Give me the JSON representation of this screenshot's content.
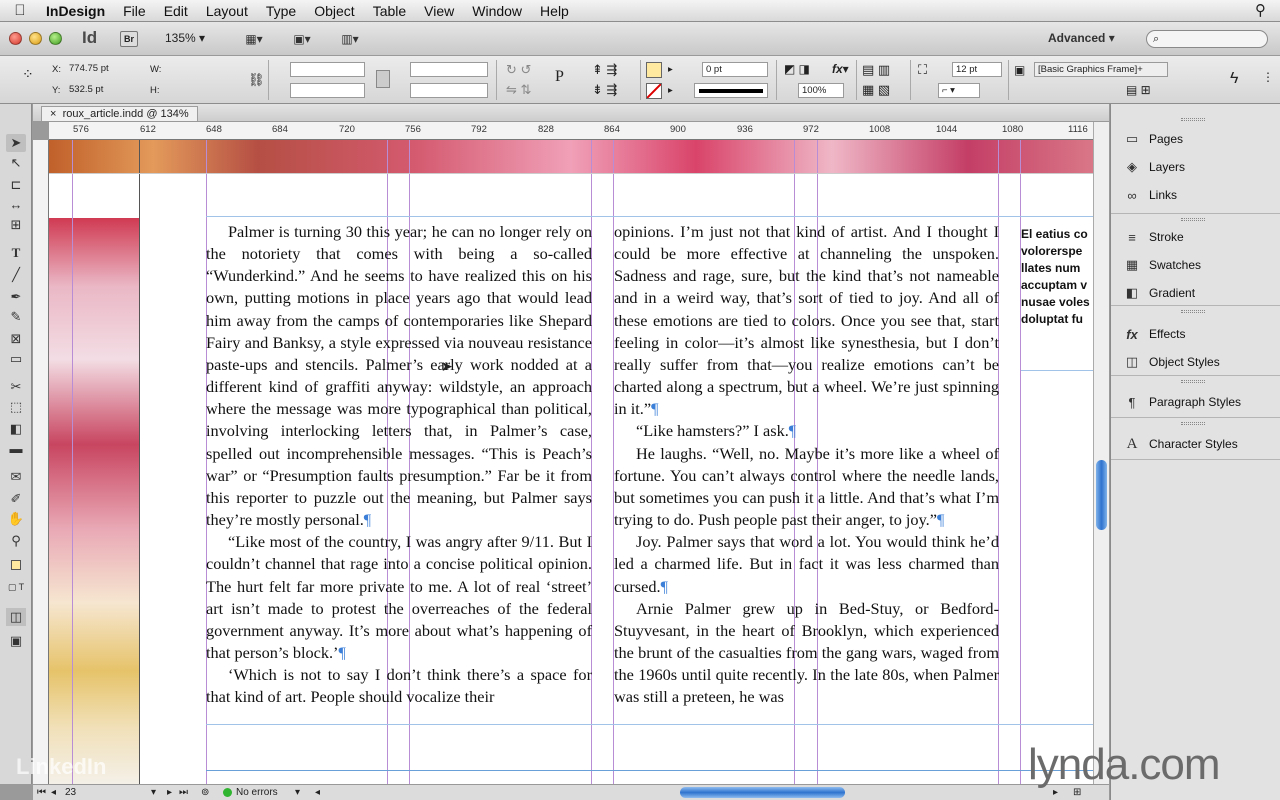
{
  "menubar": {
    "app": "InDesign",
    "menus": [
      "File",
      "Edit",
      "Layout",
      "Type",
      "Object",
      "Table",
      "View",
      "Window",
      "Help"
    ]
  },
  "appbar": {
    "logo": "Id",
    "bridge": "Br",
    "zoom": "135%",
    "workspace": "Advanced",
    "search_placeholder": "⌕"
  },
  "control": {
    "x_label": "X:",
    "x_value": "774.75 pt",
    "y_label": "Y:",
    "y_value": "532.5 pt",
    "w_label": "W:",
    "h_label": "H:",
    "stroke_weight": "0 pt",
    "opacity": "100%",
    "spacing": "12 pt",
    "object_style": "[Basic Graphics Frame]+"
  },
  "doc": {
    "tab_title": "roux_article.indd @ 134%",
    "ruler_ticks": [
      "576",
      "612",
      "648",
      "684",
      "720",
      "756",
      "792",
      "828",
      "864",
      "900",
      "936",
      "972",
      "1008",
      "1044",
      "1080",
      "1116"
    ]
  },
  "article": {
    "col1": [
      "Palmer is turning 30 this year; he can no longer rely on the notoriety that comes with being a so-called “Wunderkind.” And he seems to have realized this on his own, putting motions in place years ago that would lead him away from the camps of contemporaries like Shepard Fairy and Banksy, a style expressed via nouveau resistance paste-ups and stencils. Palmer’s early work nodded at a different kind of graffiti anyway: wildstyle, an approach where the message was more typographical than political, involving interlocking letters that, in Palmer’s case, spelled out incomprehensible messages. “This is Peach’s war” or “Presumption faults presumption.” Far be it from this reporter to puzzle out the meaning, but Palmer says they’re mostly personal.",
      "“Like most of the country, I was angry after 9/11. But I couldn’t channel that rage into a concise political opinion. The hurt felt far more private to me. A lot of real ‘street’ art isn’t made to protest the overreaches of the federal government anyway. It’s more about what’s happening of that person’s block.’",
      "‘Which is not to say I don’t think there’s a space for that kind of art. People should vocalize their"
    ],
    "col2": [
      "opinions. I’m just not that kind of artist. And I thought I could be more effective at channeling the unspoken. Sadness and rage, sure, but the kind that’s not nameable and in a weird way, that’s sort of tied to joy. And all of these emotions are tied to colors. Once you see that, start feeling in color—it’s almost like synesthesia, but I don’t really suffer from that—you realize emotions can’t be charted along a spectrum, but a wheel. We’re just spinning in it.”",
      "“Like hamsters?” I ask.",
      "He laughs. “Well, no. Maybe it’s more like a wheel of fortune. You can’t always control where the needle lands, but sometimes you can push it a little. And that’s what I’m trying to do. Push people past their anger, to joy.”",
      "Joy. Palmer says that word a lot. You would think he’d led a charmed life. But in fact it was less charmed than cursed.",
      "Arnie Palmer grew up in Bed-Stuy, or Bedford-Stuyvesant, in the heart of Brooklyn, which experienced the brunt of the casualties from the gang wars, waged from the 1960s until quite recently. In the late 80s, when Palmer was still a preteen, he was"
    ],
    "pilcrow": "¶",
    "sidebar_lines": [
      "El eatius co",
      "volorerspe",
      "llates num",
      "accuptam v",
      "nusae voles",
      "doluptat fu"
    ]
  },
  "status": {
    "page": "23",
    "preflight": "No errors"
  },
  "panels": {
    "group1": [
      {
        "label": "Pages",
        "icon": "pages-icon",
        "glyph": "▭"
      },
      {
        "label": "Layers",
        "icon": "layers-icon",
        "glyph": "◈"
      },
      {
        "label": "Links",
        "icon": "links-icon",
        "glyph": "∞"
      }
    ],
    "group2": [
      {
        "label": "Stroke",
        "icon": "stroke-icon",
        "glyph": "≡"
      },
      {
        "label": "Swatches",
        "icon": "swatches-icon",
        "glyph": "▦"
      },
      {
        "label": "Gradient",
        "icon": "gradient-icon",
        "glyph": "◧"
      }
    ],
    "group3": [
      {
        "label": "Effects",
        "icon": "effects-icon",
        "glyph": "fx"
      },
      {
        "label": "Object Styles",
        "icon": "object-styles-icon",
        "glyph": "◫"
      }
    ],
    "group4": [
      {
        "label": "Paragraph Styles",
        "icon": "paragraph-styles-icon",
        "glyph": "¶"
      }
    ],
    "group5": [
      {
        "label": "Character Styles",
        "icon": "character-styles-icon",
        "glyph": "A"
      }
    ]
  },
  "watermark": {
    "lynda": "lynda.com",
    "linkedin": "LinkedIn"
  },
  "colors": {
    "guide": "#b98dd6",
    "selection": "#2e73cf"
  }
}
